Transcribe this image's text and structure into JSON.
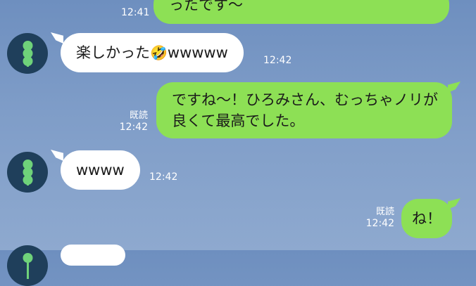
{
  "chat": {
    "messages": [
      {
        "id": "m0",
        "side": "out",
        "text": "ったです〜",
        "read": "",
        "time": "12:41"
      },
      {
        "id": "m1",
        "side": "in",
        "text": "楽しかった",
        "emoji": "🤣",
        "suffix": "wwwww",
        "time": "12:42"
      },
      {
        "id": "m2",
        "side": "out",
        "line1": "ですね〜！ひろみさん、むっちゃノリが",
        "line2": "良くて最高でした。",
        "read": "既読",
        "time": "12:42"
      },
      {
        "id": "m3",
        "side": "in",
        "text": "wwww",
        "time": "12:42"
      },
      {
        "id": "m4",
        "side": "out",
        "text": "ね！",
        "read": "既読",
        "time": "12:42"
      }
    ]
  },
  "colors": {
    "out_bubble": "#8de055",
    "in_bubble": "#ffffff",
    "background": "#7f9dc8",
    "avatar_bg": "#1f3f5b",
    "avatar_fg": "#6fd27a"
  },
  "icons": {
    "avatar": "dango-icon",
    "emoji": "rolling-laughing-face"
  }
}
